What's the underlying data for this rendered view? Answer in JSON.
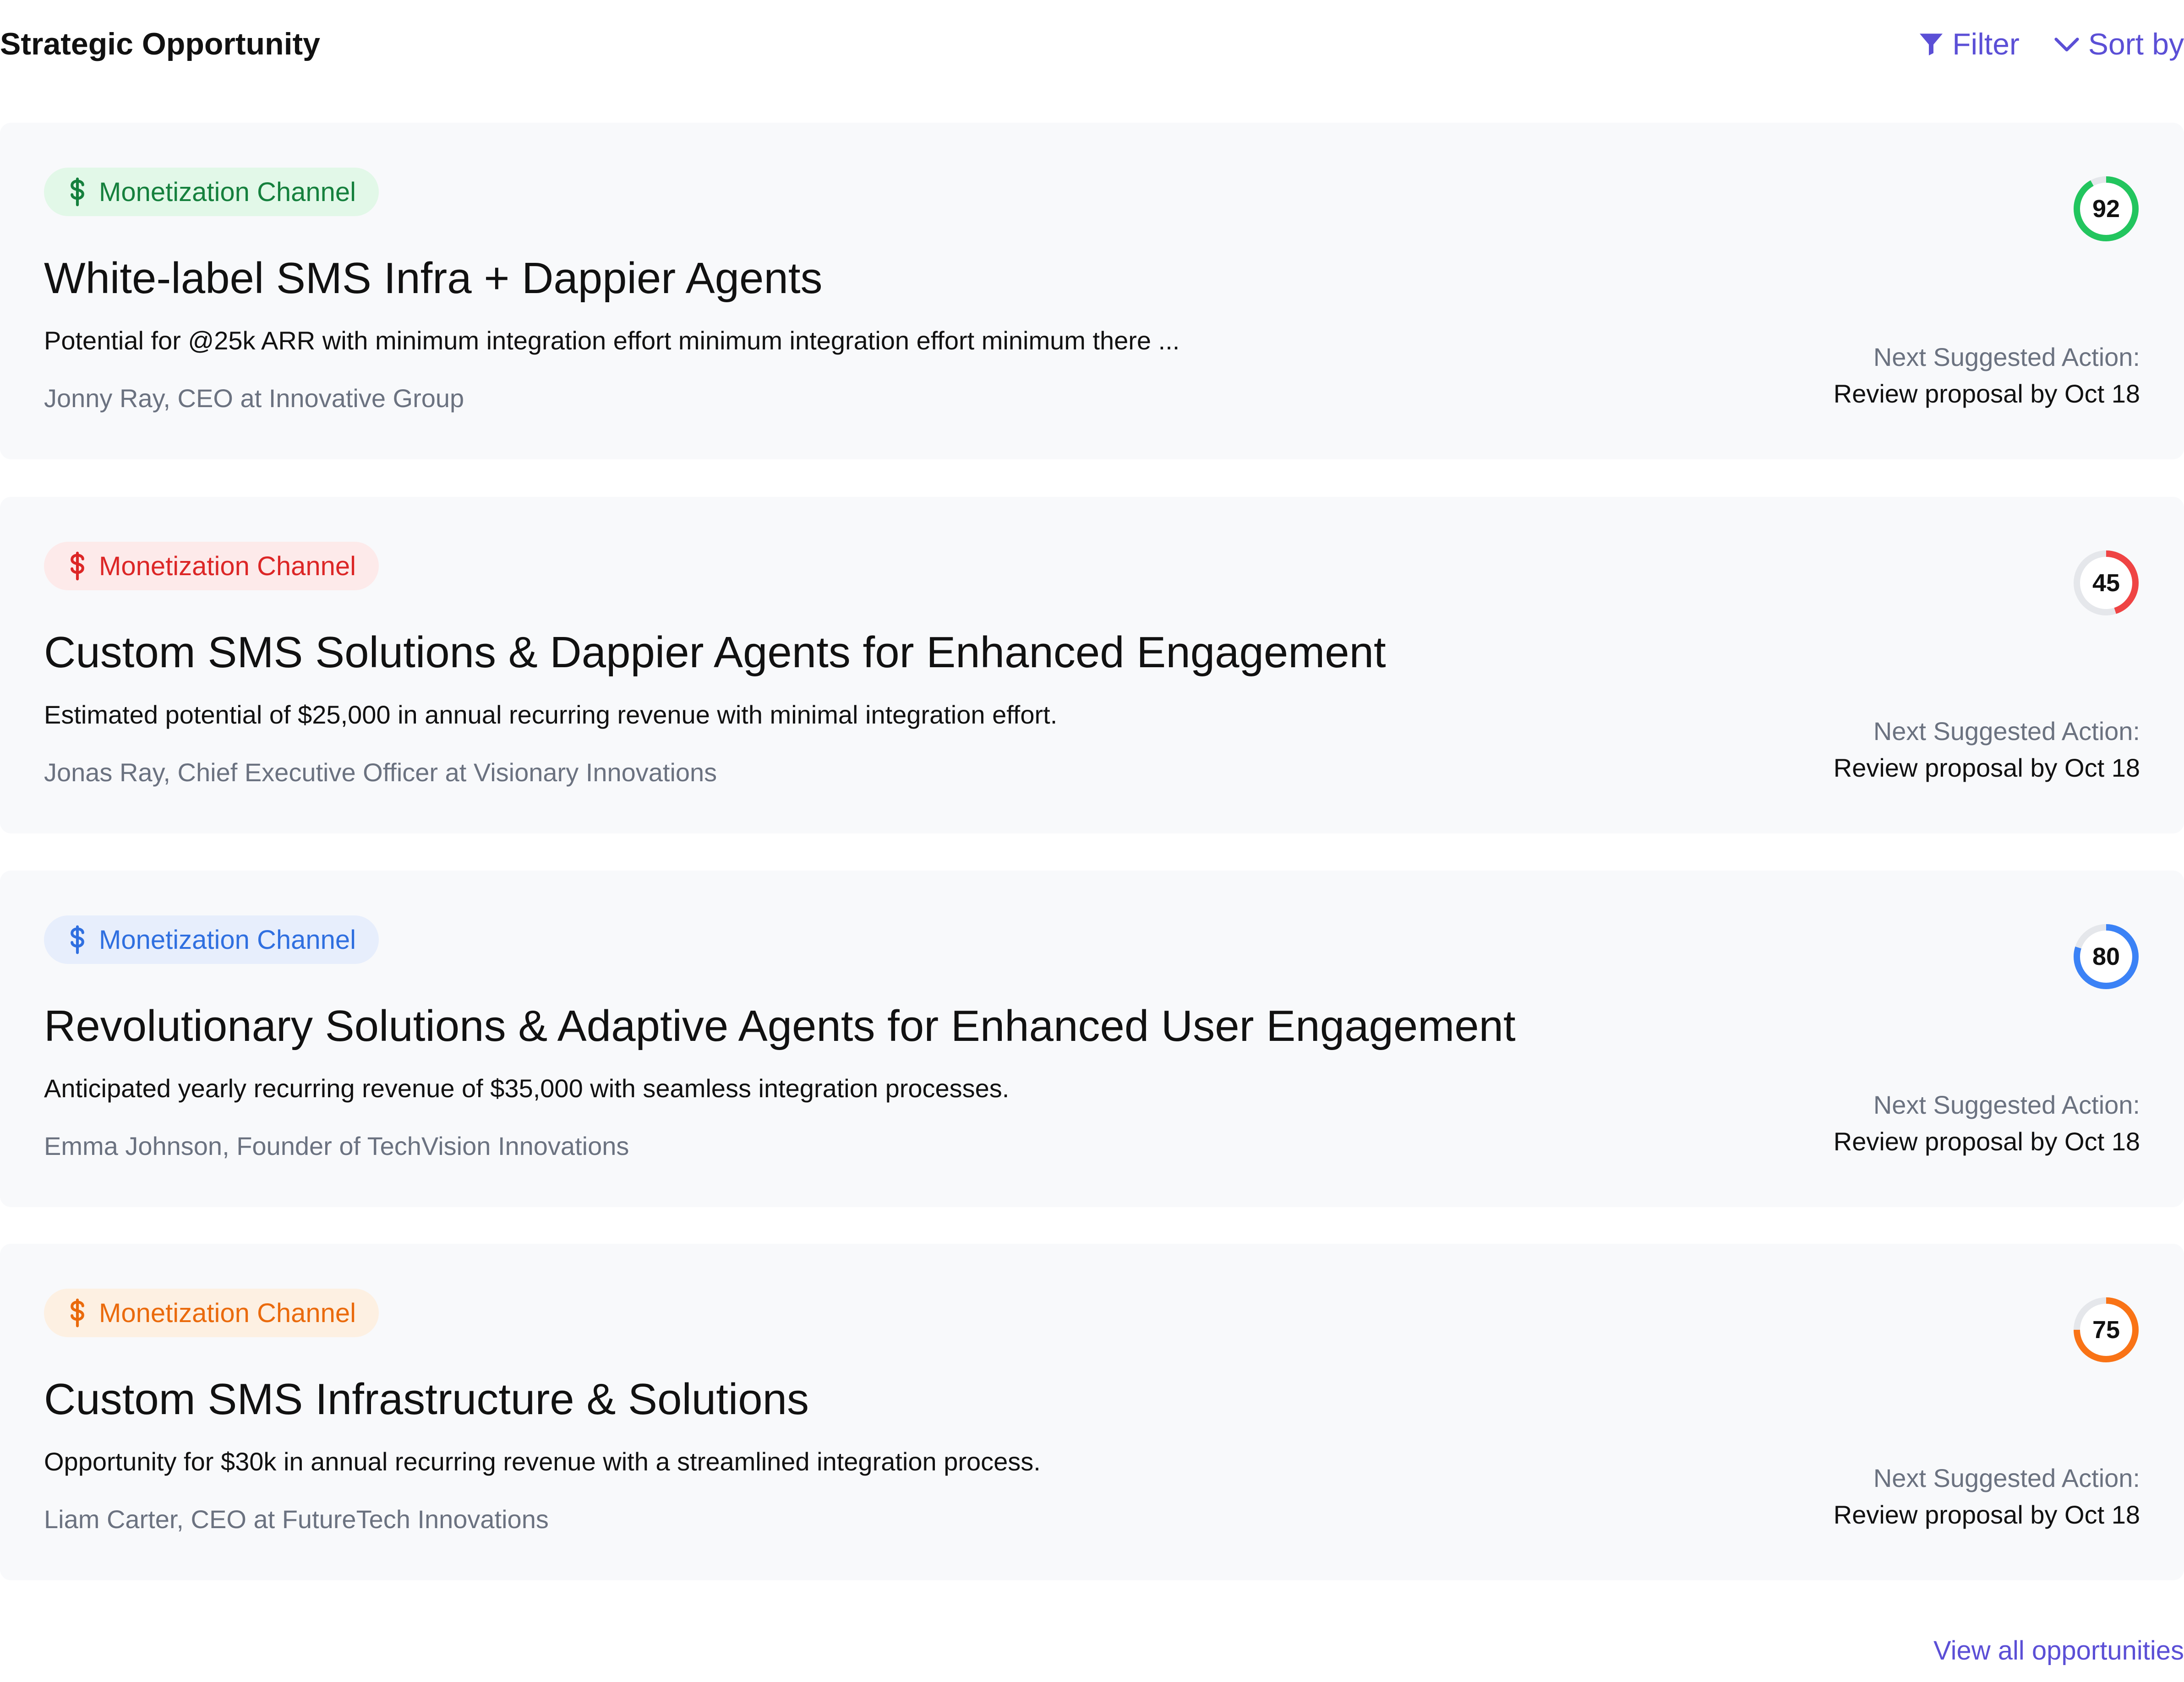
{
  "header": {
    "title": "Strategic Opportunity",
    "filter_label": "Filter",
    "sort_label": "Sort by"
  },
  "colors": {
    "accent": "#5b4fd6",
    "card_background": "#f8f9fb",
    "green": "#22c55e",
    "red": "#ef4444",
    "blue": "#3b82f6",
    "orange": "#f97316"
  },
  "cards": [
    {
      "badge": "Monetization Channel",
      "badge_icon": "dollar-icon",
      "badge_color": "green",
      "title": "White-label SMS Infra + Dappier Agents",
      "description": "Potential for @25k ARR with  minimum integration effort  minimum integration effort  minimum there ...",
      "person": "Jonny Ray, CEO at  Innovative Group",
      "score": 92,
      "next_action_label": "Next Suggested Action:",
      "next_action": "Review proposal by Oct 18"
    },
    {
      "badge": "Monetization Channel",
      "badge_icon": "dollar-icon",
      "badge_color": "red",
      "title": "Custom SMS Solutions & Dappier Agents for Enhanced Engagement",
      "description": "Estimated potential of $25,000 in annual recurring revenue with minimal integration effort.",
      "person": "Jonas Ray, Chief Executive Officer at Visionary Innovations",
      "score": 45,
      "next_action_label": "Next Suggested Action:",
      "next_action": "Review proposal by Oct 18"
    },
    {
      "badge": "Monetization Channel",
      "badge_icon": "dollar-icon",
      "badge_color": "blue",
      "title": "Revolutionary Solutions & Adaptive Agents for Enhanced User Engagement",
      "description": "Anticipated yearly recurring revenue of $35,000 with seamless integration processes.",
      "person": "Emma Johnson, Founder of TechVision Innovations",
      "score": 80,
      "next_action_label": "Next Suggested Action:",
      "next_action": "Review proposal by Oct 18"
    },
    {
      "badge": "Monetization Channel",
      "badge_icon": "dollar-icon",
      "badge_color": "orange",
      "title": "Custom SMS Infrastructure & Solutions",
      "description": "Opportunity for $30k in annual recurring revenue with a streamlined integration process.",
      "person": "Liam Carter, CEO at FutureTech Innovations",
      "score": 75,
      "next_action_label": "Next Suggested Action:",
      "next_action": "Review proposal by Oct 18"
    }
  ],
  "footer": {
    "view_all_label": "View all opportunities"
  }
}
